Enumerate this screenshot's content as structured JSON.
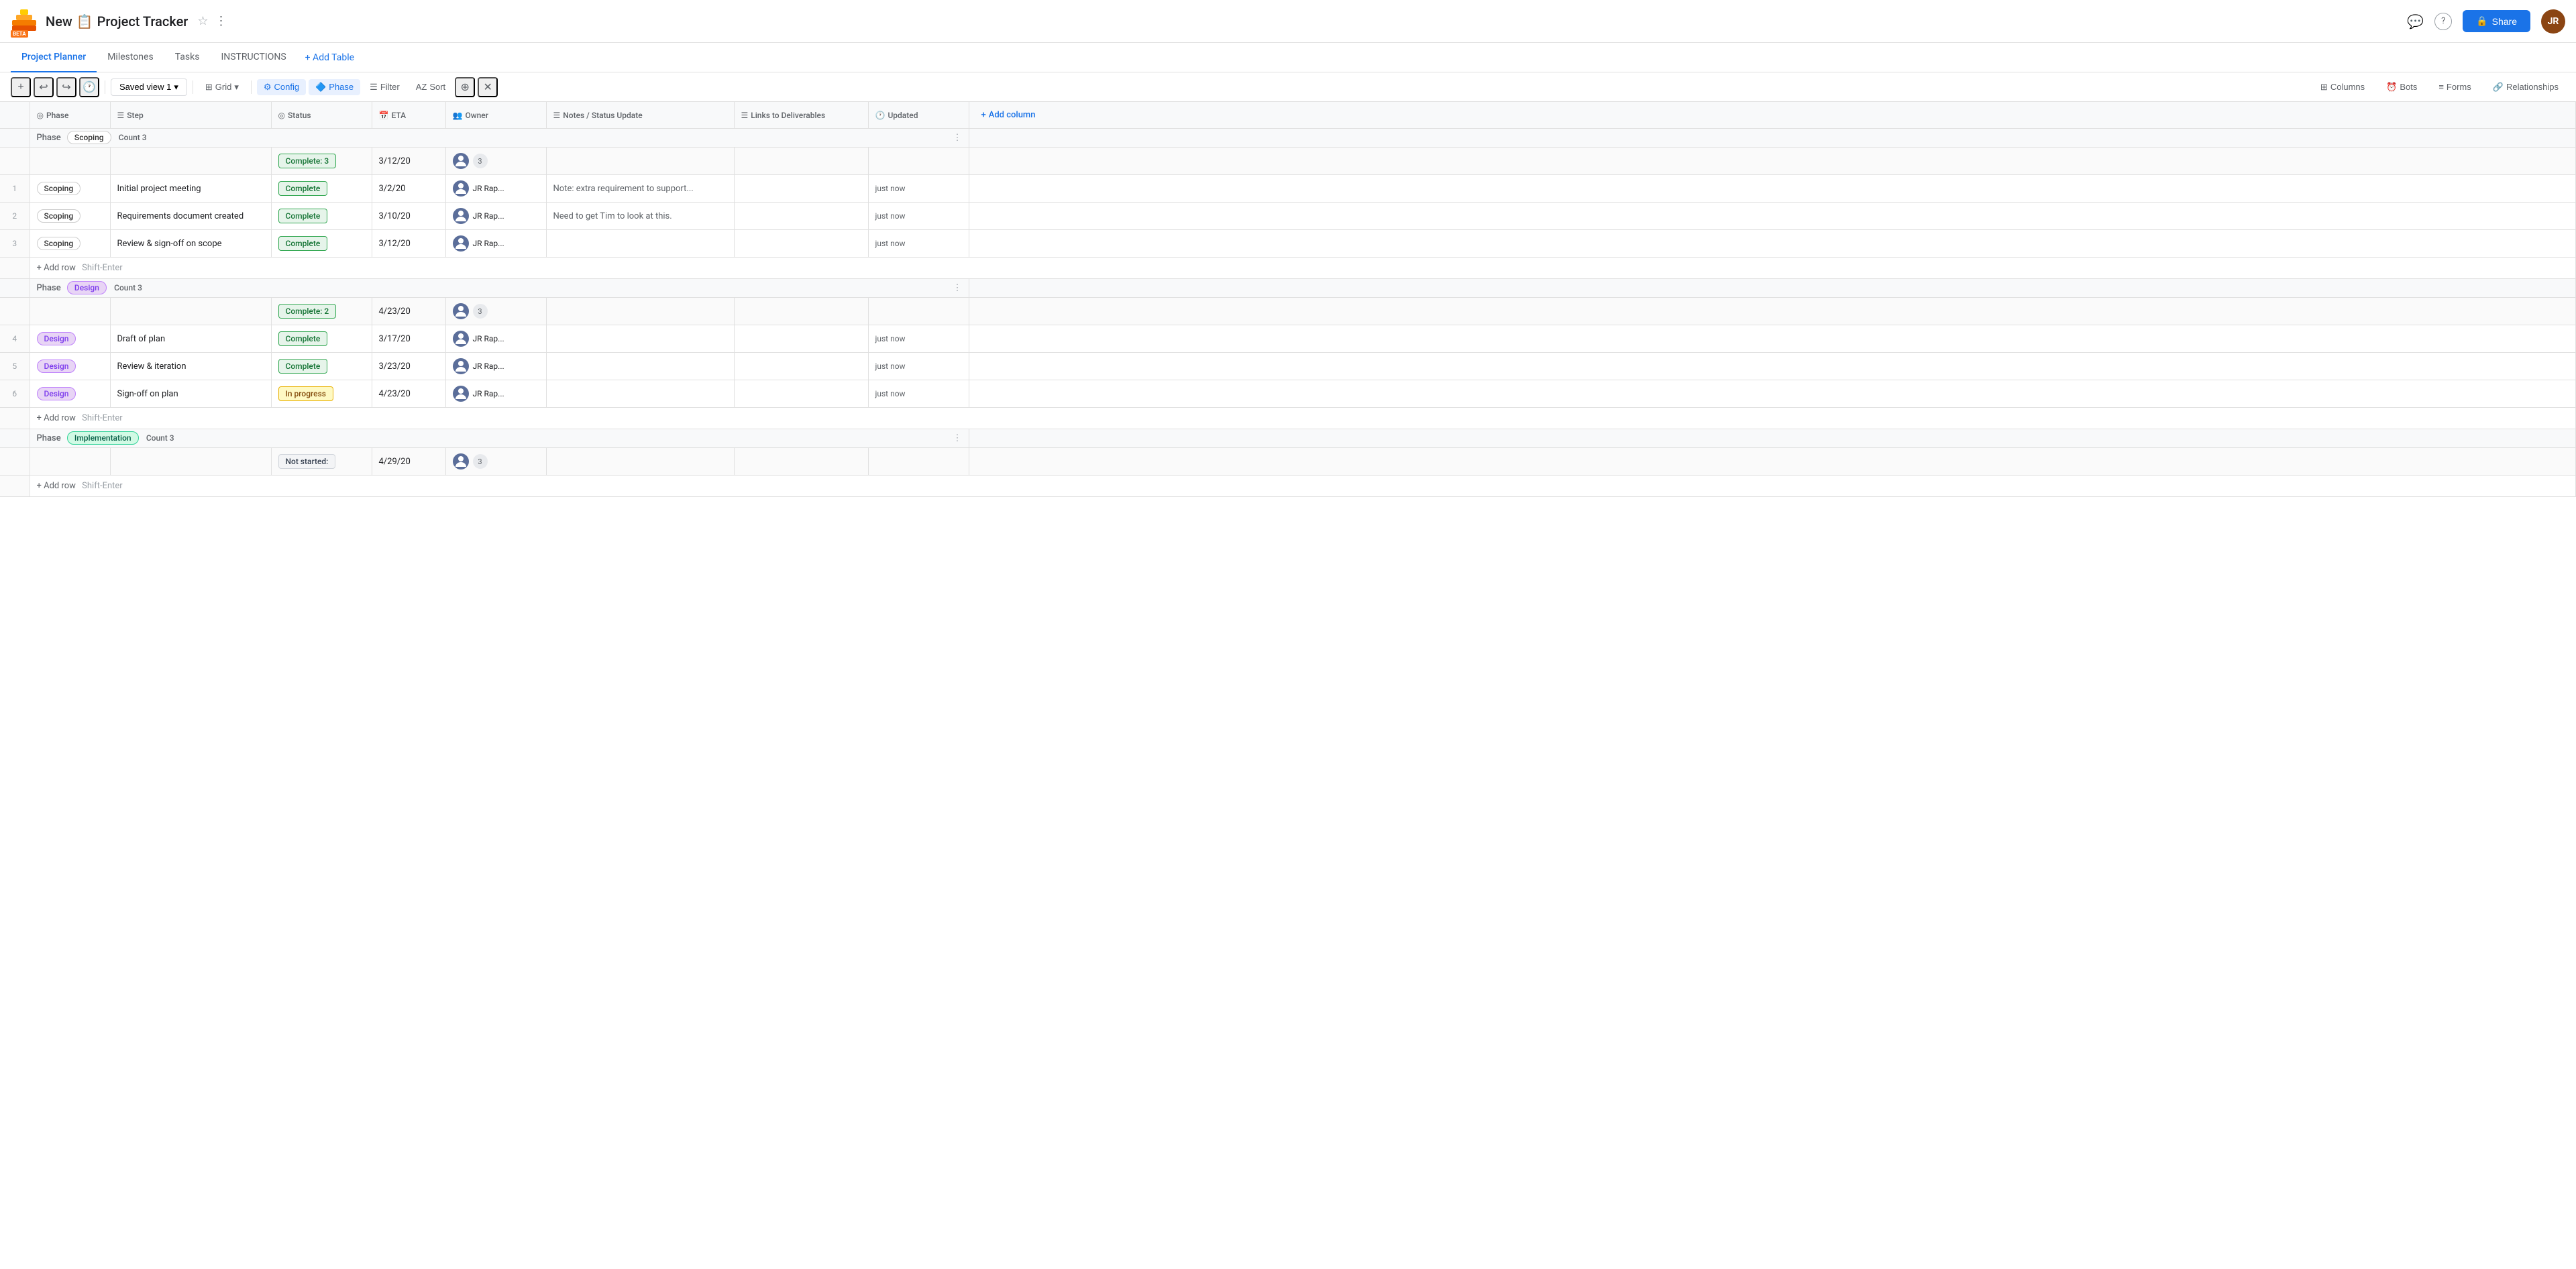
{
  "header": {
    "app_name": "New",
    "doc_icon": "📋",
    "title": "Project Tracker",
    "star_icon": "☆",
    "more_icon": "⋮",
    "share_label": "Share",
    "comment_icon": "💬",
    "help_icon": "?",
    "logo_emoji": "🟠",
    "beta_label": "BETA",
    "user_initials": "JR"
  },
  "tabs": [
    {
      "id": "project-planner",
      "label": "Project Planner",
      "active": true
    },
    {
      "id": "milestones",
      "label": "Milestones",
      "active": false
    },
    {
      "id": "tasks",
      "label": "Tasks",
      "active": false
    },
    {
      "id": "instructions",
      "label": "INSTRUCTIONS",
      "active": false
    },
    {
      "id": "add-table",
      "label": "+ Add Table",
      "active": false
    }
  ],
  "toolbar": {
    "saved_view_label": "Saved view 1",
    "grid_label": "Grid",
    "config_label": "Config",
    "phase_label": "Phase",
    "filter_label": "Filter",
    "sort_label": "Sort",
    "columns_label": "Columns",
    "bots_label": "Bots",
    "forms_label": "Forms",
    "relationships_label": "Relationships"
  },
  "columns": [
    {
      "id": "row-num",
      "icon": "",
      "label": ""
    },
    {
      "id": "phase",
      "icon": "◎",
      "label": "Phase"
    },
    {
      "id": "step",
      "icon": "☰",
      "label": "Step"
    },
    {
      "id": "status",
      "icon": "◎",
      "label": "Status"
    },
    {
      "id": "eta",
      "icon": "📅",
      "label": "ETA"
    },
    {
      "id": "owner",
      "icon": "👥",
      "label": "Owner"
    },
    {
      "id": "notes",
      "icon": "☰",
      "label": "Notes / Status Update"
    },
    {
      "id": "links",
      "icon": "☰",
      "label": "Links to Deliverables"
    },
    {
      "id": "updated",
      "icon": "🕐",
      "label": "Updated"
    },
    {
      "id": "addcol",
      "icon": "+",
      "label": "+ Add column"
    }
  ],
  "groups": [
    {
      "id": "scoping",
      "phase": "Scoping",
      "phase_class": "phase-scoping",
      "count": 3,
      "summary": {
        "status": "Complete: 3",
        "status_class": "status-complete-count",
        "eta": "3/12/20",
        "owner_count": "3"
      },
      "rows": [
        {
          "num": "1",
          "phase": "Scoping",
          "phase_class": "phase-scoping",
          "step": "Initial project meeting",
          "status": "Complete",
          "status_class": "status-complete",
          "eta": "3/2/20",
          "owner_name": "JR Rap...",
          "notes": "Note: extra requirement to support...",
          "links": "",
          "updated": "just now"
        },
        {
          "num": "2",
          "phase": "Scoping",
          "phase_class": "phase-scoping",
          "step": "Requirements document created",
          "status": "Complete",
          "status_class": "status-complete",
          "eta": "3/10/20",
          "owner_name": "JR Rap...",
          "notes": "Need to get Tim to look at this.",
          "links": "",
          "updated": "just now"
        },
        {
          "num": "3",
          "phase": "Scoping",
          "phase_class": "phase-scoping",
          "step": "Review & sign-off on scope",
          "status": "Complete",
          "status_class": "status-complete",
          "eta": "3/12/20",
          "owner_name": "JR Rap...",
          "notes": "",
          "links": "",
          "updated": "just now"
        }
      ]
    },
    {
      "id": "design",
      "phase": "Design",
      "phase_class": "phase-design",
      "count": 3,
      "summary": {
        "status": "Complete: 2",
        "status_class": "status-complete-count",
        "eta": "4/23/20",
        "owner_count": "3"
      },
      "rows": [
        {
          "num": "4",
          "phase": "Design",
          "phase_class": "phase-design",
          "step": "Draft of plan",
          "status": "Complete",
          "status_class": "status-complete",
          "eta": "3/17/20",
          "owner_name": "JR Rap...",
          "notes": "",
          "links": "",
          "updated": "just now"
        },
        {
          "num": "5",
          "phase": "Design",
          "phase_class": "phase-design",
          "step": "Review & iteration",
          "status": "Complete",
          "status_class": "status-complete",
          "eta": "3/23/20",
          "owner_name": "JR Rap...",
          "notes": "",
          "links": "",
          "updated": "just now"
        },
        {
          "num": "6",
          "phase": "Design",
          "phase_class": "phase-design",
          "step": "Sign-off on plan",
          "status": "In progress",
          "status_class": "status-inprogress",
          "eta": "4/23/20",
          "owner_name": "JR Rap...",
          "notes": "",
          "links": "",
          "updated": "just now"
        }
      ]
    },
    {
      "id": "implementation",
      "phase": "Implementation",
      "phase_class": "phase-implementation",
      "count": 3,
      "summary": {
        "status": "Not started: ",
        "status_class": "status-notstarted",
        "eta": "4/29/20",
        "owner_count": "3"
      },
      "rows": []
    }
  ],
  "add_row_label": "+ Add row",
  "add_row_shortcut": "Shift-Enter",
  "updated_label": "Updated"
}
